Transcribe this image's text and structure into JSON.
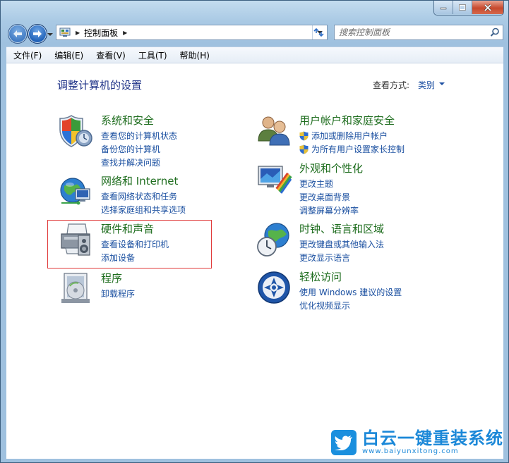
{
  "window": {
    "controls": {
      "minimize": "minimize",
      "maximize": "maximize",
      "close": "close"
    }
  },
  "navigation": {
    "breadcrumb": "控制面板",
    "search_placeholder": "搜索控制面板"
  },
  "menu": [
    {
      "label": "文件(F)"
    },
    {
      "label": "编辑(E)"
    },
    {
      "label": "查看(V)"
    },
    {
      "label": "工具(T)"
    },
    {
      "label": "帮助(H)"
    }
  ],
  "content": {
    "title": "调整计算机的设置",
    "view_by_label": "查看方式:",
    "view_by_value": "类别"
  },
  "categories": {
    "system": {
      "title": "系统和安全",
      "links": [
        "查看您的计算机状态",
        "备份您的计算机",
        "查找并解决问题"
      ]
    },
    "network": {
      "title": "网络和 Internet",
      "links": [
        "查看网络状态和任务",
        "选择家庭组和共享选项"
      ]
    },
    "hardware": {
      "title": "硬件和声音",
      "links": [
        "查看设备和打印机",
        "添加设备"
      ]
    },
    "programs": {
      "title": "程序",
      "links": [
        "卸载程序"
      ]
    },
    "users": {
      "title": "用户帐户和家庭安全",
      "links": [
        "添加或删除用户帐户",
        "为所有用户设置家长控制"
      ]
    },
    "appearance": {
      "title": "外观和个性化",
      "links": [
        "更改主题",
        "更改桌面背景",
        "调整屏幕分辨率"
      ]
    },
    "clock": {
      "title": "时钟、语言和区域",
      "links": [
        "更改键盘或其他输入法",
        "更改显示语言"
      ]
    },
    "ease": {
      "title": "轻松访问",
      "links": [
        "使用 Windows 建议的设置",
        "优化视频显示"
      ]
    }
  },
  "watermark": {
    "title": "白云一键重装系统",
    "url": "www.baiyunxitong.com"
  },
  "colors": {
    "category_title": "#1e6d1e",
    "link": "#1a4fa0",
    "page_title": "#1e3287",
    "highlight": "#e03a3a",
    "watermark": "#1b88d8"
  }
}
